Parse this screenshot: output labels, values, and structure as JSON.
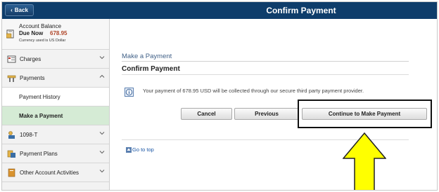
{
  "header": {
    "back_label": "Back",
    "title": "Confirm Payment",
    "bar_color": "#0e3d6b"
  },
  "sidebar": {
    "balance": {
      "title": "Account Balance",
      "due_label": "Due Now",
      "due_amount": "678.95",
      "currency_note": "Currency used is US Dollar"
    },
    "items": [
      {
        "label": "Charges",
        "icon": "charges-icon",
        "expanded": false
      },
      {
        "label": "Payments",
        "icon": "payments-icon",
        "expanded": true
      },
      {
        "label": "Payment History",
        "sub": true
      },
      {
        "label": "Make a Payment",
        "sub": true,
        "active": true
      },
      {
        "label": "1098-T",
        "icon": "tax-form-icon",
        "expanded": false
      },
      {
        "label": "Payment Plans",
        "icon": "payment-plans-icon",
        "expanded": false
      },
      {
        "label": "Other Account Activities",
        "icon": "account-activities-icon",
        "expanded": false
      }
    ],
    "active_color": "#d5ebd5"
  },
  "main": {
    "section_title": "Make a Payment",
    "page_heading": "Confirm Payment",
    "message": "Your payment of 678.95 USD will be collected through our secure third party payment provider.",
    "buttons": {
      "cancel": "Cancel",
      "previous": "Previous",
      "continue": "Continue to Make Payment"
    },
    "go_to_top": "Go to top"
  },
  "annotation": {
    "arrow_color": "#ffff00",
    "highlight_target": "Continue to Make Payment"
  }
}
